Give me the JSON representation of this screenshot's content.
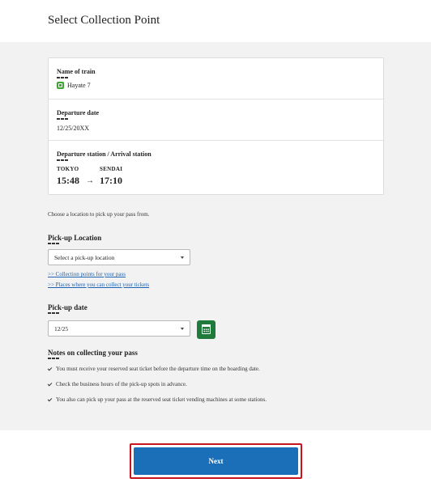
{
  "page": {
    "title": "Select Collection Point"
  },
  "train_info": {
    "name_label": "Name of train",
    "train_name": "Hayate 7",
    "date_label": "Departure date",
    "date_value": "12/25/20XX",
    "stations_label": "Departure station / Arrival station",
    "departure_station": "TOKYO",
    "arrival_station": "SENDAI",
    "departure_time": "15:48",
    "arrival_time": "17:10",
    "arrow": "→"
  },
  "intro_text": "Choose a location to pick up your pass from.",
  "pickup_location": {
    "label": "Pick-up Location",
    "selected": "Select a pick-up location",
    "links": [
      ">> Collection points for your pass",
      ">> Places where you can collect your tickets"
    ]
  },
  "pickup_date": {
    "label": "Pick-up date",
    "selected": "12/25",
    "calendar_icon": "calendar-icon"
  },
  "notes": {
    "title": "Notes on collecting your pass",
    "items": [
      "You must receive your reserved seat ticket before the departure time on the boarding date.",
      "Check the business hours of the pick-up spots in advance.",
      "You also can pick up your pass at the reserved seat ticket vending machines at some stations."
    ]
  },
  "footer": {
    "next_label": "Next"
  },
  "colors": {
    "accent": "#1a6fb8",
    "highlight": "#c8141e",
    "calendar": "#1f7a3b",
    "train_icon": "#3fa535"
  }
}
